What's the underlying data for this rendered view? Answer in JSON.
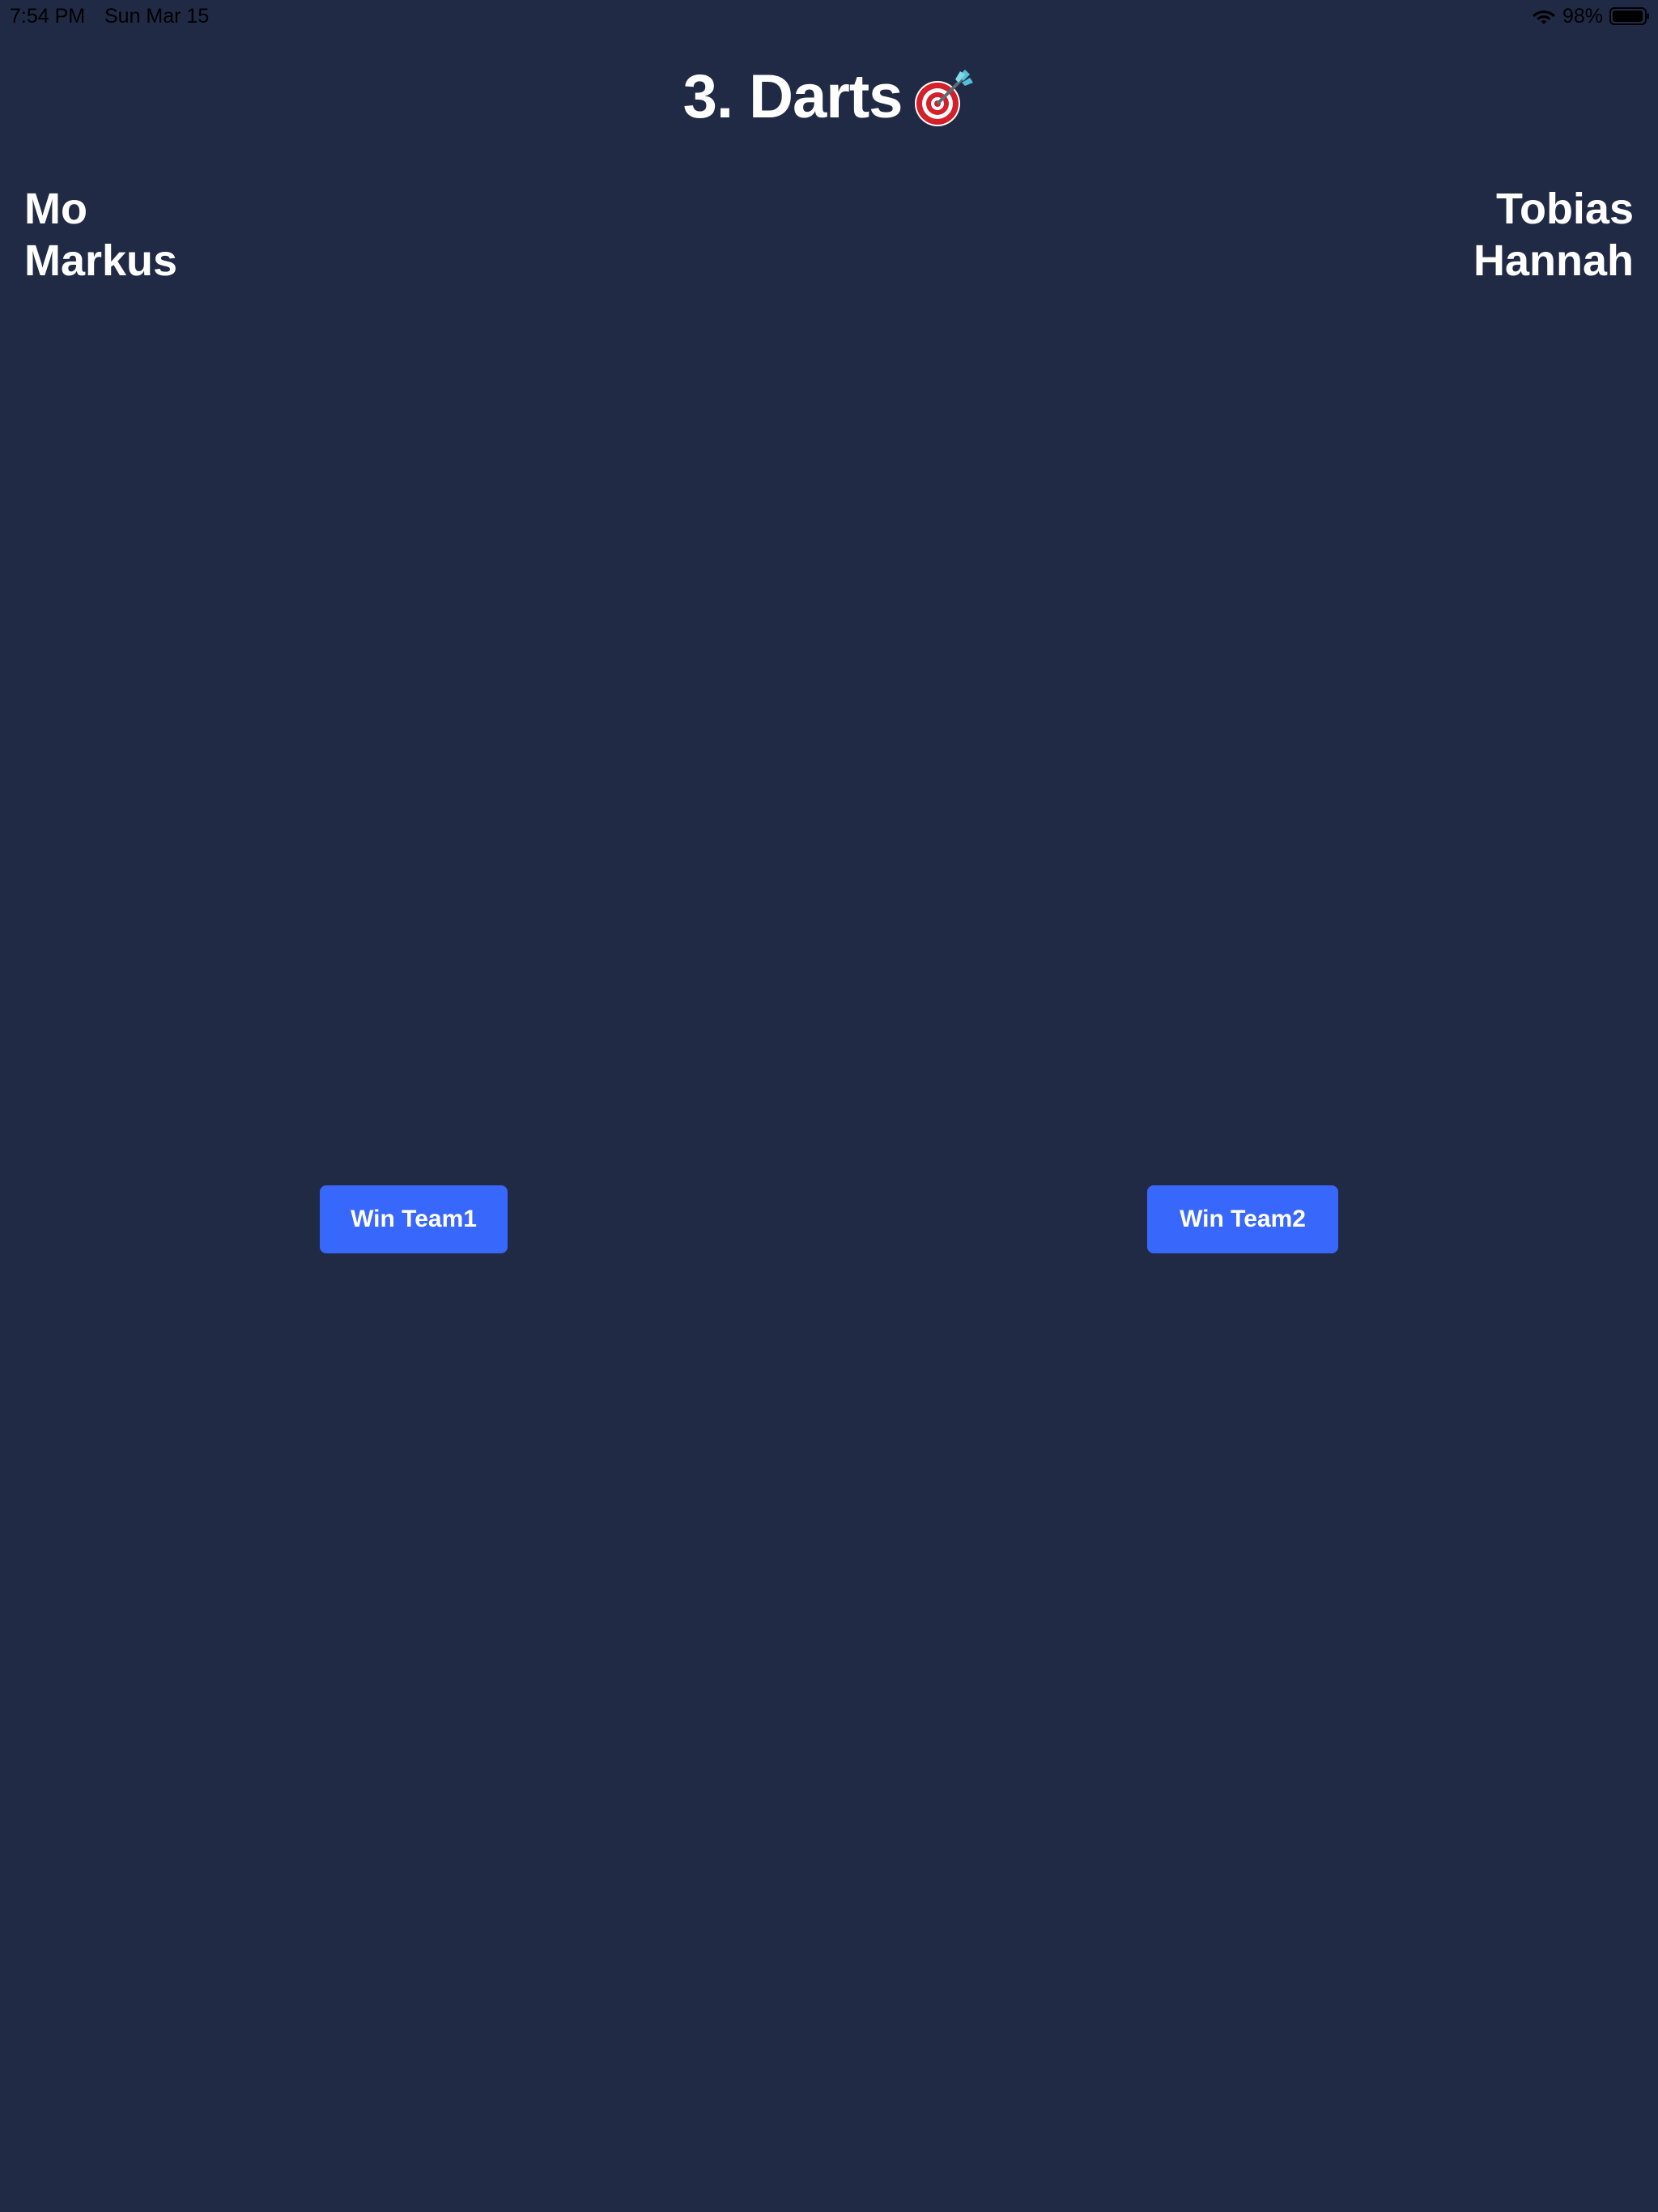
{
  "status_bar": {
    "time": "7:54 PM",
    "date": "Sun Mar 15",
    "battery_percent": "98%",
    "icons": [
      "wifi-icon",
      "battery-icon"
    ]
  },
  "header": {
    "title": "3. Darts",
    "title_icon": "dartboard-icon"
  },
  "teams": {
    "team1": {
      "players": [
        "Mo",
        "Markus"
      ]
    },
    "team2": {
      "players": [
        "Tobias",
        "Hannah"
      ]
    }
  },
  "actions": {
    "win_team1_label": "Win Team1",
    "win_team2_label": "Win Team2"
  },
  "colors": {
    "background": "#212a44",
    "button": "#3867fb",
    "text": "#ffffff",
    "status_text": "#000000"
  }
}
